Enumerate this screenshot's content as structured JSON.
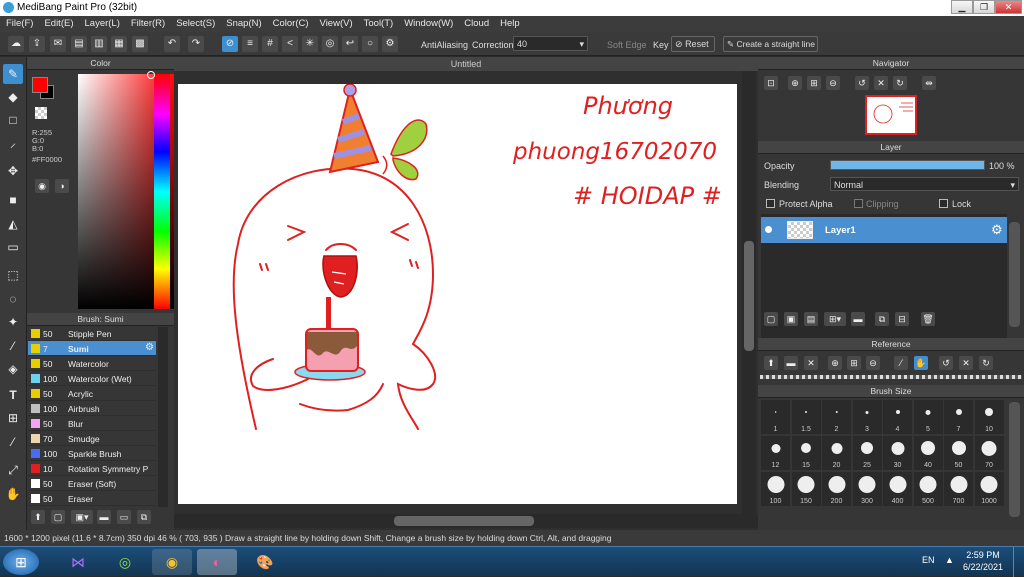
{
  "window": {
    "title": "MediBang Paint Pro (32bit)",
    "min_label": "▁",
    "max_label": "❐",
    "close_label": "✕"
  },
  "menu": [
    "File(F)",
    "Edit(E)",
    "Layer(L)",
    "Filter(R)",
    "Select(S)",
    "Snap(N)",
    "Color(C)",
    "View(V)",
    "Tool(T)",
    "Window(W)",
    "Cloud",
    "Help"
  ],
  "toolbar": {
    "antialiasing_label": "AntiAliasing",
    "correction_label": "Correction",
    "correction_value": "40",
    "soft_edge_label": "Soft Edge",
    "key_label": "Key",
    "reset_label": "Reset",
    "straight_line_label": "Create a straight line"
  },
  "color_panel": {
    "title": "Color",
    "r": "R:255",
    "g": "G:0",
    "b": "B:0",
    "hex": "#FF0000",
    "primary_color": "#ff0000",
    "secondary_color": "#000000"
  },
  "brush_panel": {
    "title": "Brush: Sumi",
    "items": [
      {
        "size": "50",
        "name": "Stipple Pen",
        "color": "#e8d000"
      },
      {
        "size": "7",
        "name": "Sumi",
        "color": "#e8d000"
      },
      {
        "size": "50",
        "name": "Watercolor",
        "color": "#e8d000"
      },
      {
        "size": "100",
        "name": "Watercolor (Wet)",
        "color": "#6fd1f0"
      },
      {
        "size": "50",
        "name": "Acrylic",
        "color": "#e8d000"
      },
      {
        "size": "100",
        "name": "Airbrush",
        "color": "#bfbfbf"
      },
      {
        "size": "50",
        "name": "Blur",
        "color": "#f4a3f0"
      },
      {
        "size": "70",
        "name": "Smudge",
        "color": "#f0d4b0"
      },
      {
        "size": "100",
        "name": "Sparkle Brush",
        "color": "#4a6cf0"
      },
      {
        "size": "10",
        "name": "Rotation Symmetry P",
        "color": "#e02020"
      },
      {
        "size": "50",
        "name": "Eraser (Soft)",
        "color": "#ffffff"
      },
      {
        "size": "50",
        "name": "Eraser",
        "color": "#ffffff"
      }
    ]
  },
  "canvas": {
    "tab_title": "Untitled",
    "handwriting_1": "Phương",
    "handwriting_2": "phuong16702070",
    "handwriting_3": "# HOIDAP #"
  },
  "navigator": {
    "title": "Navigator"
  },
  "layer_panel": {
    "title": "Layer",
    "opacity_label": "Opacity",
    "opacity_value": "100 %",
    "opacity_fraction": 1.0,
    "blending_label": "Blending",
    "blending_value": "Normal",
    "protect_alpha_label": "Protect Alpha",
    "clipping_label": "Clipping",
    "lock_label": "Lock",
    "layer_name": "Layer1"
  },
  "reference": {
    "title": "Reference"
  },
  "brush_size": {
    "title": "Brush Size",
    "sizes": [
      "1",
      "1.5",
      "2",
      "3",
      "4",
      "5",
      "7",
      "10",
      "12",
      "15",
      "20",
      "25",
      "30",
      "40",
      "50",
      "70",
      "100",
      "150",
      "200",
      "300",
      "400",
      "500",
      "700",
      "1000"
    ]
  },
  "status": {
    "text": "1600 * 1200 pixel   (11.6 * 8.7cm)   350 dpi   46 %   ( 703, 935 )   Draw a straight line by holding down Shift, Change a brush size by holding down Ctrl, Alt, and dragging"
  },
  "taskbar": {
    "lang": "EN",
    "time": "2:59 PM",
    "date": "6/22/2021"
  }
}
